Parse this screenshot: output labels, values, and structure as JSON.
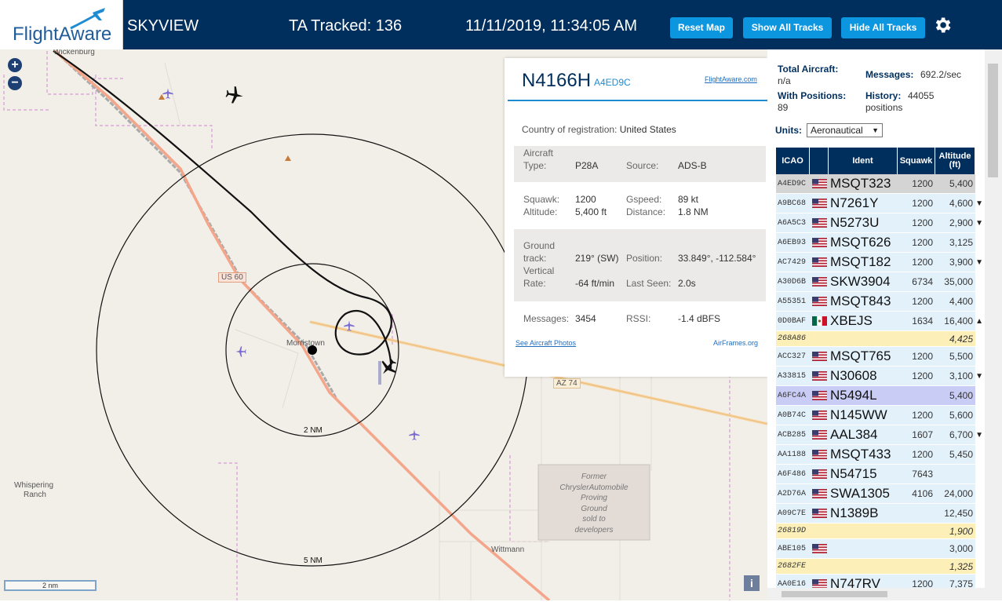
{
  "header": {
    "logo_text": "FlightAware",
    "site": "SKYVIEW",
    "tracked": "TA Tracked: 136",
    "datetime": "11/11/2019, 11:34:05 AM",
    "reset": "Reset Map",
    "show_all": "Show All Tracks",
    "hide_all": "Hide All Tracks"
  },
  "map": {
    "labels": {
      "wickenburg": "Wickenburg",
      "us60": "US 60",
      "morristown": "Morristown",
      "az74": "AZ 74",
      "ring2": "2 NM",
      "ring5": "5 NM",
      "whispering": "Whispering",
      "ranch": "Ranch",
      "former1": "Former",
      "former2": "ChryslerAutomobile",
      "former3": "Proving",
      "former4": "Ground",
      "former5": "sold to",
      "former6": "developers",
      "wittmann": "Wittmann"
    },
    "scale": "2 nm",
    "zoom_in": "+",
    "zoom_out": "−",
    "info": "i"
  },
  "popup": {
    "registration": "N4166H",
    "hex": "A4ED9C",
    "fa_link": "FlightAware.com",
    "country_label": "Country of registration:",
    "country": "United States",
    "aircraft_label": "Aircraft",
    "type_label": "Type:",
    "type": "P28A",
    "source_label": "Source:",
    "source": "ADS-B",
    "squawk_label": "Squawk:",
    "squawk": "1200",
    "gspeed_label": "Gspeed:",
    "gspeed": "89 kt",
    "altitude_label": "Altitude:",
    "altitude": "5,400 ft",
    "distance_label": "Distance:",
    "distance": "1.8 NM",
    "ground_label": "Ground",
    "track_label": "track:",
    "track": "219° (SW)",
    "position_label": "Position:",
    "position": "33.849°, -112.584°",
    "vertical_label": "Vertical",
    "rate_label": "Rate:",
    "rate": "-64 ft/min",
    "lastseen_label": "Last Seen:",
    "lastseen": "2.0s",
    "messages_label": "Messages:",
    "messages": "3454",
    "rssi_label": "RSSI:",
    "rssi": "-1.4 dBFS",
    "photos": "See Aircraft Photos",
    "airframes": "AirFrames.org"
  },
  "panel": {
    "total_label": "Total Aircraft:",
    "total": "n/a",
    "messages_label": "Messages:",
    "messages": "692.2/sec",
    "withpos_label": "With Positions:",
    "withpos": "89",
    "history_label": "History:",
    "history": "44055",
    "history_unit": "positions",
    "units_label": "Units:",
    "units_value": "Aeronautical"
  },
  "table": {
    "headers": [
      "ICAO",
      "",
      "Ident",
      "Squawk",
      "Altitude (ft)"
    ],
    "rows": [
      {
        "icao": "A4ED9C",
        "flag": "us",
        "ident": "MSQT323",
        "squawk": "1200",
        "alt": "5,400",
        "trend": "",
        "bg": "sel"
      },
      {
        "icao": "A9BC68",
        "flag": "us",
        "ident": "N7261Y",
        "squawk": "1200",
        "alt": "4,600",
        "trend": "▼",
        "bg": "blue"
      },
      {
        "icao": "A6A5C3",
        "flag": "us",
        "ident": "N5273U",
        "squawk": "1200",
        "alt": "2,900",
        "trend": "▼",
        "bg": "blue"
      },
      {
        "icao": "A6EB93",
        "flag": "us",
        "ident": "MSQT626",
        "squawk": "1200",
        "alt": "3,125",
        "trend": "",
        "bg": "blue"
      },
      {
        "icao": "AC7429",
        "flag": "us",
        "ident": "MSQT182",
        "squawk": "1200",
        "alt": "3,900",
        "trend": "▼",
        "bg": "blue"
      },
      {
        "icao": "A30D6B",
        "flag": "us",
        "ident": "SKW3904",
        "squawk": "6734",
        "alt": "35,000",
        "trend": "",
        "bg": "blue"
      },
      {
        "icao": "A55351",
        "flag": "us",
        "ident": "MSQT843",
        "squawk": "1200",
        "alt": "4,400",
        "trend": "",
        "bg": "blue"
      },
      {
        "icao": "0D0BAF",
        "flag": "mx",
        "ident": "XBEJS",
        "squawk": "1634",
        "alt": "16,400",
        "trend": "▲",
        "bg": "blue"
      },
      {
        "icao": "268A86",
        "flag": "",
        "ident": "",
        "squawk": "",
        "alt": "4,425",
        "trend": "",
        "bg": "yellow"
      },
      {
        "icao": "ACC327",
        "flag": "us",
        "ident": "MSQT765",
        "squawk": "1200",
        "alt": "5,500",
        "trend": "",
        "bg": "blue"
      },
      {
        "icao": "A33815",
        "flag": "us",
        "ident": "N30608",
        "squawk": "1200",
        "alt": "3,100",
        "trend": "▼",
        "bg": "blue"
      },
      {
        "icao": "A6FC4A",
        "flag": "us",
        "ident": "N5494L",
        "squawk": "",
        "alt": "5,400",
        "trend": "",
        "bg": "purple"
      },
      {
        "icao": "A0B74C",
        "flag": "us",
        "ident": "N145WW",
        "squawk": "1200",
        "alt": "5,600",
        "trend": "",
        "bg": "blue"
      },
      {
        "icao": "ACB285",
        "flag": "us",
        "ident": "AAL384",
        "squawk": "1607",
        "alt": "6,700",
        "trend": "▼",
        "bg": "blue"
      },
      {
        "icao": "AA1188",
        "flag": "us",
        "ident": "MSQT433",
        "squawk": "1200",
        "alt": "5,450",
        "trend": "",
        "bg": "blue"
      },
      {
        "icao": "A6F486",
        "flag": "us",
        "ident": "N54715",
        "squawk": "7643",
        "alt": "",
        "trend": "",
        "bg": "blue"
      },
      {
        "icao": "A2D76A",
        "flag": "us",
        "ident": "SWA1305",
        "squawk": "4106",
        "alt": "24,000",
        "trend": "",
        "bg": "blue"
      },
      {
        "icao": "A09C7E",
        "flag": "us",
        "ident": "N1389B",
        "squawk": "",
        "alt": "12,450",
        "trend": "",
        "bg": "blue"
      },
      {
        "icao": "26819D",
        "flag": "",
        "ident": "",
        "squawk": "",
        "alt": "1,900",
        "trend": "",
        "bg": "yellow"
      },
      {
        "icao": "ABE105",
        "flag": "us",
        "ident": "",
        "squawk": "",
        "alt": "3,000",
        "trend": "",
        "bg": "blue"
      },
      {
        "icao": "2682FE",
        "flag": "",
        "ident": "",
        "squawk": "",
        "alt": "1,325",
        "trend": "",
        "bg": "yellow"
      },
      {
        "icao": "AA0E16",
        "flag": "us",
        "ident": "N747RV",
        "squawk": "1200",
        "alt": "7,375",
        "trend": "",
        "bg": "blue"
      }
    ]
  },
  "colors": {
    "header_bg": "#002f5d",
    "button": "#0d96e0",
    "row_blue": "#e3f1fb",
    "row_yellow": "#fcf0b8",
    "row_sel": "#d4d4d4",
    "row_purple": "#c9ccf5",
    "track": "#111111",
    "road": "#f4a58a"
  }
}
